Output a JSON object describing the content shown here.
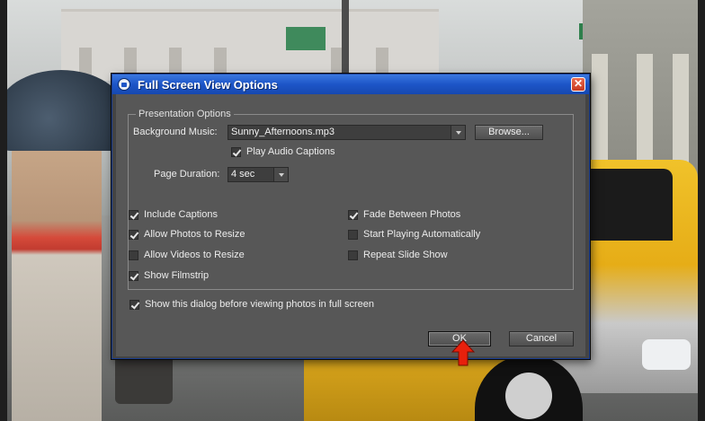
{
  "dialog": {
    "title": "Full Screen View Options",
    "close_glyph": "✕"
  },
  "presentation": {
    "legend": "Presentation Options",
    "background_music_label": "Background Music:",
    "background_music_value": "Sunny_Afternoons.mp3",
    "browse_label": "Browse...",
    "play_audio_captions_label": "Play Audio Captions",
    "play_audio_captions_checked": true,
    "page_duration_label": "Page Duration:",
    "page_duration_value": "4 sec"
  },
  "options_left": [
    {
      "label": "Include Captions",
      "checked": true
    },
    {
      "label": "Allow Photos to Resize",
      "checked": true
    },
    {
      "label": "Allow Videos to Resize",
      "checked": false
    },
    {
      "label": "Show Filmstrip",
      "checked": true
    }
  ],
  "options_right": [
    {
      "label": "Fade Between Photos",
      "checked": true
    },
    {
      "label": "Start Playing Automatically",
      "checked": false
    },
    {
      "label": "Repeat Slide Show",
      "checked": false
    }
  ],
  "show_dialog": {
    "label": "Show this dialog before viewing photos in full screen",
    "checked": true
  },
  "buttons": {
    "ok_label": "OK",
    "cancel_label": "Cancel"
  },
  "colors": {
    "titlebar": "#1d55c7",
    "panel": "#575757",
    "pointer_arrow": "#e8200c"
  }
}
